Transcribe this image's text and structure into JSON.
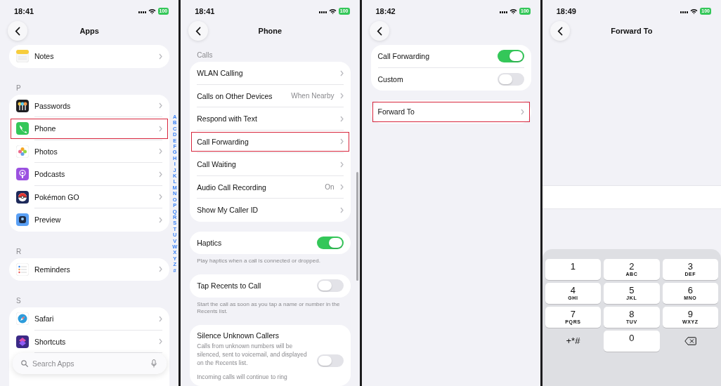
{
  "screens": [
    {
      "kind": "list",
      "status": {
        "time": "18:41",
        "battery": "100"
      },
      "title": "Apps",
      "sections": [
        {
          "rows": [
            {
              "kind": "app",
              "label": "Notes",
              "highlighted": false,
              "dimmed": false
            }
          ]
        },
        {
          "header": "P",
          "rows": [
            {
              "kind": "app",
              "label": "Passwords",
              "highlighted": false,
              "dimmed": false
            },
            {
              "kind": "app",
              "label": "Phone",
              "highlighted": true,
              "dimmed": false
            },
            {
              "kind": "app",
              "label": "Photos",
              "highlighted": false,
              "dimmed": false
            },
            {
              "kind": "app",
              "label": "Podcasts",
              "highlighted": false,
              "dimmed": false
            },
            {
              "kind": "app",
              "label": "Pokémon GO",
              "highlighted": false,
              "dimmed": false
            },
            {
              "kind": "app",
              "label": "Preview",
              "highlighted": false,
              "dimmed": false
            }
          ]
        },
        {
          "header": "R",
          "rows": [
            {
              "kind": "app",
              "label": "Reminders",
              "highlighted": false,
              "dimmed": false
            }
          ]
        },
        {
          "header": "S",
          "rows": [
            {
              "kind": "app",
              "label": "Safari",
              "highlighted": false,
              "dimmed": false
            },
            {
              "kind": "app",
              "label": "Shortcuts",
              "highlighted": false,
              "dimmed": false
            },
            {
              "kind": "covered"
            },
            {
              "kind": "covered"
            }
          ]
        }
      ],
      "index": [
        "A",
        "B",
        "C",
        "D",
        "E",
        "F",
        "G",
        "H",
        "I",
        "J",
        "K",
        "L",
        "M",
        "N",
        "O",
        "P",
        "Q",
        "R",
        "S",
        "T",
        "U",
        "V",
        "W",
        "X",
        "Y",
        "Z",
        "#"
      ],
      "search": {
        "placeholder": "Search Apps"
      }
    },
    {
      "kind": "list",
      "status": {
        "time": "18:41",
        "battery": "100"
      },
      "title": "Phone",
      "scrollbar": true,
      "sections": [
        {
          "header": "Calls",
          "rows": [
            {
              "kind": "link",
              "label": "WLAN Calling",
              "highlighted": false
            },
            {
              "kind": "link",
              "label": "Calls on Other Devices",
              "value": "When Nearby",
              "highlighted": false
            },
            {
              "kind": "link",
              "label": "Respond with Text",
              "highlighted": false
            },
            {
              "kind": "link",
              "label": "Call Forwarding",
              "highlighted": true
            },
            {
              "kind": "link",
              "label": "Call Waiting",
              "highlighted": false
            },
            {
              "kind": "link",
              "label": "Audio Call Recording",
              "value": "On",
              "highlighted": false
            },
            {
              "kind": "link",
              "label": "Show My Caller ID",
              "highlighted": false
            }
          ]
        },
        {
          "rows": [
            {
              "kind": "toggle",
              "label": "Haptics",
              "on": true
            }
          ],
          "footer": "Play haptics when a call is connected or dropped."
        },
        {
          "rows": [
            {
              "kind": "toggle",
              "label": "Tap Recents to Call",
              "on": false
            }
          ],
          "footer": "Start the call as soon as you tap a name or number in the Recents list."
        },
        {
          "rows": [
            {
              "kind": "toggle",
              "label": "Silence Unknown Callers",
              "description": "Calls from unknown numbers will be silenced, sent to voicemail, and displayed on the Recents list.",
              "note": "Incoming calls will continue to ring",
              "on": false
            }
          ]
        }
      ]
    },
    {
      "kind": "list",
      "status": {
        "time": "18:42",
        "battery": "100"
      },
      "sections": [
        {
          "rows": [
            {
              "kind": "toggle",
              "label": "Call Forwarding",
              "on": true
            },
            {
              "kind": "toggle",
              "label": "Custom",
              "on": false
            }
          ]
        },
        {
          "rows": [
            {
              "kind": "link",
              "label": "Forward To",
              "highlighted": true
            }
          ]
        }
      ]
    },
    {
      "kind": "keypad_entry",
      "status": {
        "time": "18:49",
        "battery": "100"
      },
      "title": "Forward To",
      "keypad": [
        {
          "kind": "digit",
          "digit": "1"
        },
        {
          "kind": "digit",
          "digit": "2",
          "letters": "ABC"
        },
        {
          "kind": "digit",
          "digit": "3",
          "letters": "DEF"
        },
        {
          "kind": "digit",
          "digit": "4",
          "letters": "GHI"
        },
        {
          "kind": "digit",
          "digit": "5",
          "letters": "JKL"
        },
        {
          "kind": "digit",
          "digit": "6",
          "letters": "MNO"
        },
        {
          "kind": "digit",
          "digit": "7",
          "letters": "PQRS"
        },
        {
          "kind": "digit",
          "digit": "8",
          "letters": "TUV"
        },
        {
          "kind": "digit",
          "digit": "9",
          "letters": "WXYZ"
        },
        {
          "kind": "symbols",
          "digit": "+*#"
        },
        {
          "kind": "digit",
          "digit": "0"
        },
        {
          "kind": "delete"
        }
      ]
    }
  ]
}
